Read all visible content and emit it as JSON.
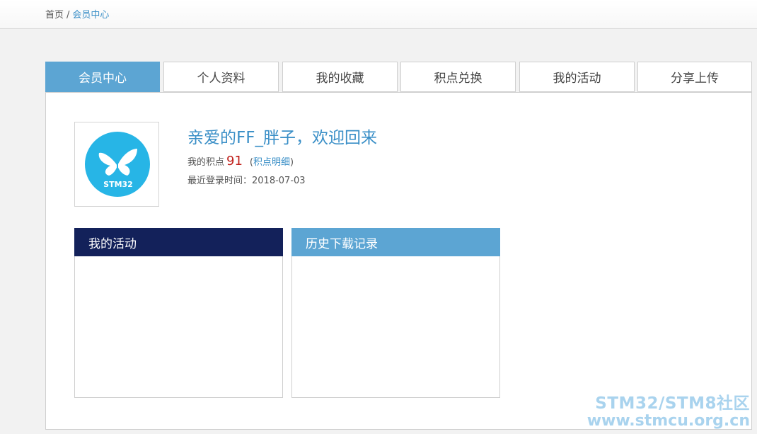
{
  "breadcrumb": {
    "home": "首页",
    "separator": "/",
    "current": "会员中心"
  },
  "tabs": [
    {
      "label": "会员中心",
      "active": true
    },
    {
      "label": "个人资料",
      "active": false
    },
    {
      "label": "我的收藏",
      "active": false
    },
    {
      "label": "积点兑换",
      "active": false
    },
    {
      "label": "我的活动",
      "active": false
    },
    {
      "label": "分享上传",
      "active": false
    }
  ],
  "profile": {
    "avatar_text": "STM32",
    "welcome": "亲爱的FF_胖子，欢迎回来",
    "points_label": "我的积点",
    "points_value": "91",
    "points_detail_open": "(",
    "points_detail_link": "积点明细",
    "points_detail_close": ")",
    "last_login_label": "最近登录时间：",
    "last_login_value": "2018-07-03"
  },
  "boxes": {
    "activity_title": "我的活动",
    "downloads_title": "历史下载记录"
  },
  "watermark": {
    "line1": "STM32/STM8社区",
    "line2": "www.stmcu.org.cn"
  },
  "colors": {
    "accent": "#5ca5d3",
    "link": "#3a8fc7",
    "activity_header": "#13215a",
    "points": "#c0201b",
    "logo_circle": "#27b5e6"
  }
}
